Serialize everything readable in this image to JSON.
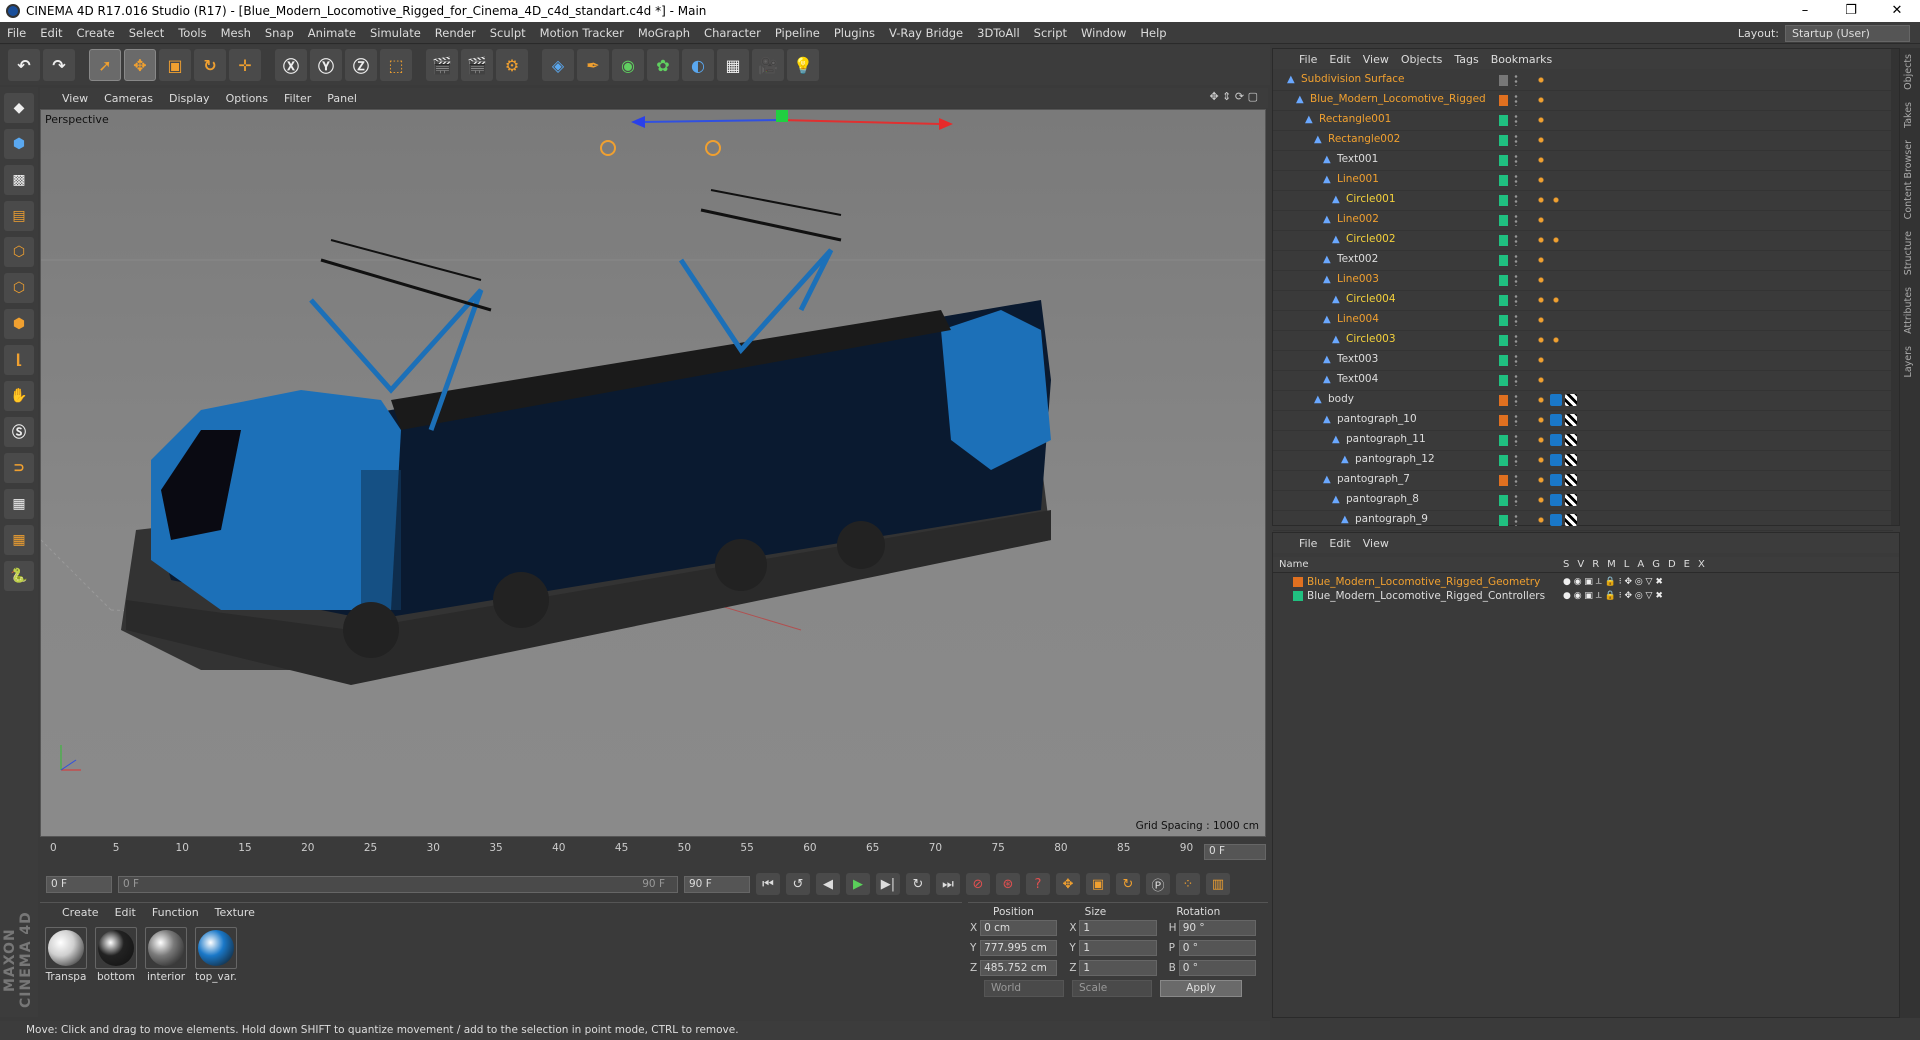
{
  "window": {
    "title": "CINEMA 4D R17.016 Studio (R17) - [Blue_Modern_Locomotive_Rigged_for_Cinema_4D_c4d_standart.c4d *] - Main",
    "minimize": "–",
    "maximize": "❐",
    "close": "✕"
  },
  "menubar": [
    "File",
    "Edit",
    "Create",
    "Select",
    "Tools",
    "Mesh",
    "Snap",
    "Animate",
    "Simulate",
    "Render",
    "Sculpt",
    "Motion Tracker",
    "MoGraph",
    "Character",
    "Pipeline",
    "Plugins",
    "V-Ray Bridge",
    "3DToAll",
    "Script",
    "Window",
    "Help"
  ],
  "layout": {
    "label": "Layout:",
    "value": "Startup (User)"
  },
  "viewport": {
    "menu": [
      "View",
      "Cameras",
      "Display",
      "Options",
      "Filter",
      "Panel"
    ],
    "label": "Perspective",
    "grid_spacing": "Grid Spacing : 1000 cm"
  },
  "timeline": {
    "ticks": [
      "0",
      "5",
      "10",
      "15",
      "20",
      "25",
      "30",
      "35",
      "40",
      "45",
      "50",
      "55",
      "60",
      "65",
      "70",
      "75",
      "80",
      "85",
      "90"
    ],
    "current_frame": "0 F",
    "start": "0 F",
    "range_start": "0 F",
    "range_end": "90 F",
    "end": "90 F"
  },
  "material_manager": {
    "menu": [
      "Create",
      "Edit",
      "Function",
      "Texture"
    ],
    "materials": [
      {
        "name": "Transpa",
        "color": "#cfcfcf"
      },
      {
        "name": "bottom",
        "color": "#222222"
      },
      {
        "name": "interior",
        "color": "#7a7a7a"
      },
      {
        "name": "top_var.",
        "color": "#1a78c8"
      }
    ]
  },
  "coordinates": {
    "headers": [
      "Position",
      "Size",
      "Rotation"
    ],
    "rows": [
      {
        "axis": "X",
        "pos": "0 cm",
        "saxis": "X",
        "size": "1",
        "raxis": "H",
        "rot": "90 °"
      },
      {
        "axis": "Y",
        "pos": "777.995 cm",
        "saxis": "Y",
        "size": "1",
        "raxis": "P",
        "rot": "0 °"
      },
      {
        "axis": "Z",
        "pos": "485.752 cm",
        "saxis": "Z",
        "size": "1",
        "raxis": "B",
        "rot": "0 °"
      }
    ],
    "mode": "World",
    "scale": "Scale",
    "apply": "Apply"
  },
  "status": "Move: Click and drag to move elements. Hold down SHIFT to quantize movement / add to the selection in point mode, CTRL to remove.",
  "object_manager": {
    "menu": [
      "File",
      "Edit",
      "View",
      "Objects",
      "Tags",
      "Bookmarks"
    ],
    "rows": [
      {
        "name": "Subdivision Surface",
        "color": "orange",
        "indent": 0
      },
      {
        "name": "Blue_Modern_Locomotive_Rigged",
        "color": "orange",
        "indent": 1
      },
      {
        "name": "Rectangle001",
        "color": "orange",
        "indent": 2
      },
      {
        "name": "Rectangle002",
        "color": "orange",
        "indent": 3
      },
      {
        "name": "Text001",
        "color": "white",
        "indent": 4
      },
      {
        "name": "Line001",
        "color": "orange",
        "indent": 4
      },
      {
        "name": "Circle001",
        "color": "yellow",
        "indent": 5
      },
      {
        "name": "Line002",
        "color": "orange",
        "indent": 4
      },
      {
        "name": "Circle002",
        "color": "yellow",
        "indent": 5
      },
      {
        "name": "Text002",
        "color": "white",
        "indent": 4
      },
      {
        "name": "Line003",
        "color": "orange",
        "indent": 4
      },
      {
        "name": "Circle004",
        "color": "yellow",
        "indent": 5
      },
      {
        "name": "Line004",
        "color": "orange",
        "indent": 4
      },
      {
        "name": "Circle003",
        "color": "yellow",
        "indent": 5
      },
      {
        "name": "Text003",
        "color": "white",
        "indent": 4
      },
      {
        "name": "Text004",
        "color": "white",
        "indent": 4
      },
      {
        "name": "body",
        "color": "white",
        "indent": 3
      },
      {
        "name": "pantograph_10",
        "color": "white",
        "indent": 4
      },
      {
        "name": "pantograph_11",
        "color": "white",
        "indent": 5
      },
      {
        "name": "pantograph_12",
        "color": "white",
        "indent": 6
      },
      {
        "name": "pantograph_7",
        "color": "white",
        "indent": 4
      },
      {
        "name": "pantograph_8",
        "color": "white",
        "indent": 5
      },
      {
        "name": "pantograph_9",
        "color": "white",
        "indent": 6
      }
    ]
  },
  "layer_manager": {
    "menu": [
      "File",
      "Edit",
      "View"
    ],
    "header_name": "Name",
    "header_cols": [
      "S",
      "V",
      "R",
      "M",
      "L",
      "A",
      "G",
      "D",
      "E",
      "X"
    ],
    "layers": [
      {
        "name": "Blue_Modern_Locomotive_Rigged_Geometry",
        "color": "#e07020",
        "text_color": "#f0a030"
      },
      {
        "name": "Blue_Modern_Locomotive_Rigged_Controllers",
        "color": "#20c080",
        "text_color": "#ddd"
      }
    ]
  },
  "side_tabs": [
    "Objects",
    "Takes",
    "Content Browser",
    "Structure",
    "Attributes",
    "Layers"
  ]
}
